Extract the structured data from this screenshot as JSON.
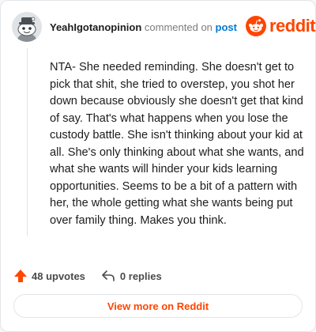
{
  "header": {
    "username": "YeahIgotanopinion",
    "action_text": "commented on",
    "post_link": "post",
    "brand": "reddit"
  },
  "comment": {
    "text": "NTA- She needed reminding. She doesn't get to pick that shit, she tried to overstep, you shot her down because obviously she doesn't get that kind of say. That's what happens when you lose the custody battle. She isn't thinking about your kid at all. She's only thinking about what she wants, and what she wants will hinder your kids learning opportunities. Seems to be a bit of a pattern with her, the whole getting what she wants being put over family thing. Makes you think."
  },
  "actions": {
    "upvotes": "48 upvotes",
    "replies": "0 replies"
  },
  "footer": {
    "view_more": "View more on Reddit"
  },
  "colors": {
    "brand": "#ff4500",
    "link": "#0079d3",
    "text": "#1c1c1c",
    "muted": "#7c7c7c"
  },
  "icons": {
    "avatar": "snoo-avatar",
    "logo": "reddit-snoo-icon",
    "upvote": "upvote-arrow-icon",
    "reply": "reply-arrow-icon"
  }
}
